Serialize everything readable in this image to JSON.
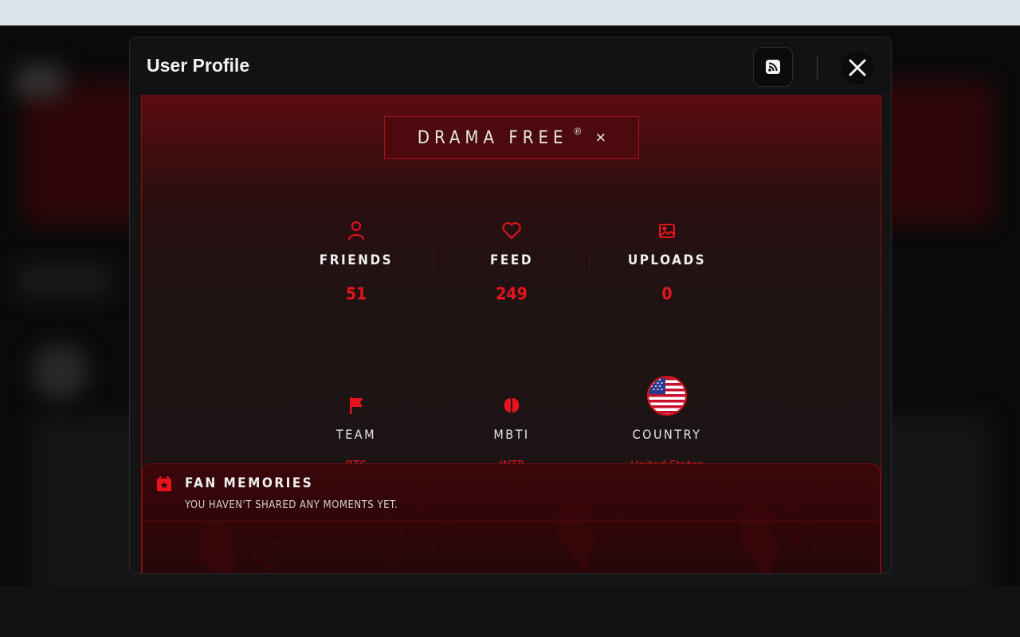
{
  "modal": {
    "title": "User Profile",
    "rss_icon": "rss-icon",
    "close_icon": "close-icon"
  },
  "badge": {
    "text": "DRAMA FREE",
    "registered": "®",
    "remove": "×"
  },
  "stats": [
    {
      "icon": "user-icon",
      "label": "FRIENDS",
      "value": "51"
    },
    {
      "icon": "heart-icon",
      "label": "FEED",
      "value": "249"
    },
    {
      "icon": "image-icon",
      "label": "UPLOADS",
      "value": "0"
    }
  ],
  "info": [
    {
      "icon": "flag-icon",
      "label": "TEAM",
      "value": "BTS"
    },
    {
      "icon": "brain-icon",
      "label": "MBTI",
      "value": "INTP"
    },
    {
      "icon": "us-flag-icon",
      "label": "COUNTRY",
      "value": "United States"
    }
  ],
  "memories": {
    "icon": "calendar-star-icon",
    "title": "FAN MEMORIES",
    "subtitle": "YOU HAVEN'T SHARED ANY MOMENTS YET."
  },
  "colors": {
    "accent": "#e8141d",
    "panel": "#141414",
    "border": "#8a0e14"
  }
}
